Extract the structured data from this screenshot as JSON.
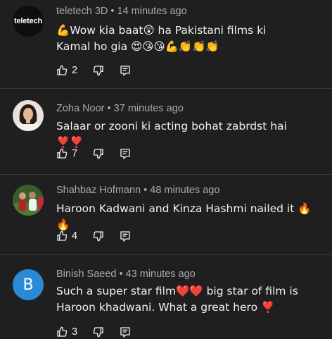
{
  "comments": [
    {
      "author": "teletech 3D",
      "time": "14 minutes ago",
      "line1": "💪Wow kia baat😲 ha Pakistani films ki",
      "line2": "Kamal ho gia 😍😘😘💪👏👏👏",
      "likes": "2",
      "avatar": {
        "type": "logo",
        "text": "teletech"
      }
    },
    {
      "author": "Zoha Noor",
      "time": "37 minutes ago",
      "line1": "Salaar or zooni ki acting bohat zabrdst hai ❣️❣️",
      "likes": "7",
      "avatar": {
        "type": "photo"
      }
    },
    {
      "author": "Shahbaz Hofmann",
      "time": "48 minutes ago",
      "line1": "Haroon Kadwani and Kinza Hashmi nailed it 🔥🔥",
      "likes": "4",
      "avatar": {
        "type": "photo"
      }
    },
    {
      "author": "Binish Saeed",
      "time": "43 minutes ago",
      "line1": "Such a super star film❤️❤️ big star of film is",
      "line2": "Haroon khadwani. What a great hero ❣️",
      "likes": "3",
      "avatar": {
        "type": "letter",
        "text": "B",
        "color": "#2a8ad6"
      }
    }
  ],
  "icons": {
    "like": "thumbs-up-icon",
    "dislike": "thumbs-down-icon",
    "reply": "reply-icon"
  },
  "colors": {
    "background": "#1f1f1f",
    "meta": "#aaaaaa",
    "text": "#f1f1f1",
    "divider": "#3a3a3a"
  }
}
